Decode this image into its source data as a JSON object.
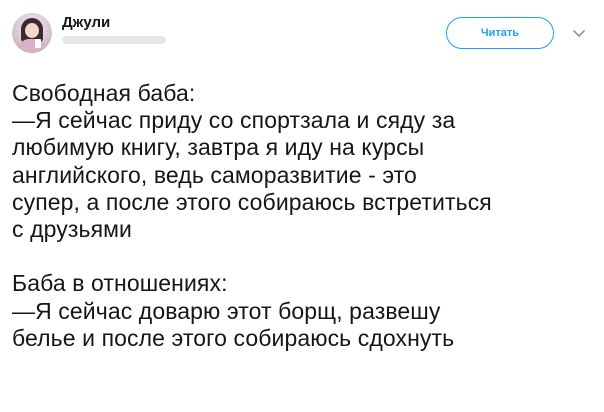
{
  "author": {
    "name": "Джули",
    "avatar_icon": "profile-photo"
  },
  "actions": {
    "follow_label": "Читать",
    "caret_icon": "chevron-down-icon"
  },
  "colors": {
    "accent": "#1da1f2",
    "text": "#14171a",
    "redaction": "#e4e7ea"
  },
  "tweet": {
    "lines": [
      "Свободная баба:",
      "—Я сейчас приду со спортзала и сяду за",
      "любимую книгу, завтра я иду на курсы",
      "английского, ведь саморазвитие - это",
      "супер, а после этого собираюсь встретиться",
      "с друзьями",
      "",
      "Баба в отношениях:",
      "—Я сейчас доварю этот борщ, развешу",
      "белье и после этого собираюсь сдохнуть"
    ]
  }
}
